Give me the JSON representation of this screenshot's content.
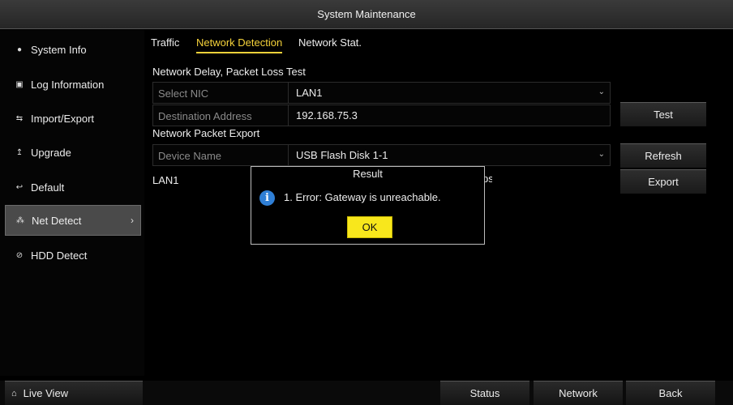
{
  "window": {
    "title": "System Maintenance"
  },
  "sidebar": {
    "items": [
      {
        "label": "System Info",
        "icon": "info-dot-icon"
      },
      {
        "label": "Log Information",
        "icon": "log-icon"
      },
      {
        "label": "Import/Export",
        "icon": "import-export-icon"
      },
      {
        "label": "Upgrade",
        "icon": "upgrade-icon"
      },
      {
        "label": "Default",
        "icon": "default-icon"
      },
      {
        "label": "Net Detect",
        "icon": "net-detect-icon",
        "active": true
      },
      {
        "label": "HDD Detect",
        "icon": "hdd-detect-icon"
      }
    ],
    "live_view": "Live View"
  },
  "tabs": [
    {
      "label": "Traffic"
    },
    {
      "label": "Network Detection",
      "active": true
    },
    {
      "label": "Network Stat."
    }
  ],
  "delay_test": {
    "heading": "Network Delay, Packet Loss Test",
    "select_nic_label": "Select NIC",
    "select_nic_value": "LAN1",
    "dest_label": "Destination Address",
    "dest_value": "192.168.75.3",
    "test_button": "Test"
  },
  "packet_export": {
    "heading": "Network Packet Export",
    "device_label": "Device Name",
    "device_value": "USB Flash Disk 1-1",
    "refresh_button": "Refresh",
    "export_button": "Export",
    "lan_label": "LAN1",
    "rate_partial": "ps"
  },
  "dialog": {
    "title": "Result",
    "message": "1. Error: Gateway is unreachable.",
    "ok": "OK"
  },
  "bottom": {
    "status": "Status",
    "network": "Network",
    "back": "Back"
  },
  "colors": {
    "accent_tab": "#f5d23a",
    "ok_button": "#f8e71c",
    "info_icon": "#2f7fd6"
  }
}
